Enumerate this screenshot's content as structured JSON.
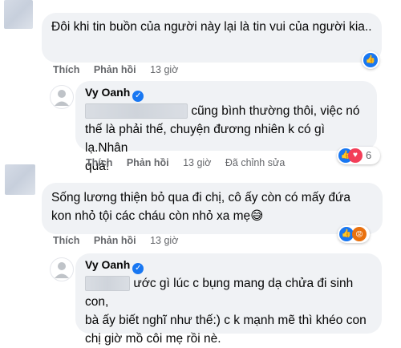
{
  "comments": [
    {
      "text": "Đôi khi tin buồn của người này lại là tin vui của người kia..",
      "actions": {
        "like": "Thích",
        "reply": "Phản hồi",
        "time": "13 giờ"
      }
    },
    {
      "author": "Vy Oanh",
      "text_line1": "cũng bình thường thôi, việc nó",
      "text_line2": "thế là phải thế, chuyện đương nhiên k có gì lạ.Nhân",
      "text_line3": "quả!",
      "reaction_count": "6",
      "actions": {
        "like": "Thích",
        "reply": "Phản hồi",
        "time": "13 giờ",
        "edited": "Đã chỉnh sửa"
      }
    },
    {
      "text_line1": "Sống lương thiện bỏ qua đi chị, cô ấy còn có mấy đứa",
      "text_line2": "kon nhỏ tội các cháu còn nhỏ xa mẹ",
      "emoji": "😅",
      "actions": {
        "like": "Thích",
        "reply": "Phản hồi",
        "time": "13 giờ"
      }
    },
    {
      "author": "Vy Oanh",
      "text_line1": "ước gì lúc c bụng mang dạ chửa đi sinh con,",
      "text_line2": "bà ấy biết nghĩ như thế:) c k mạnh mẽ thì khéo con",
      "text_line3": "chị giờ mồ côi mẹ rồi nè."
    }
  ],
  "colors": {
    "like_blue": "#1877f2",
    "love_red": "#f33e58",
    "angry_orange": "#e9710f",
    "bubble": "#f0f2f5"
  }
}
